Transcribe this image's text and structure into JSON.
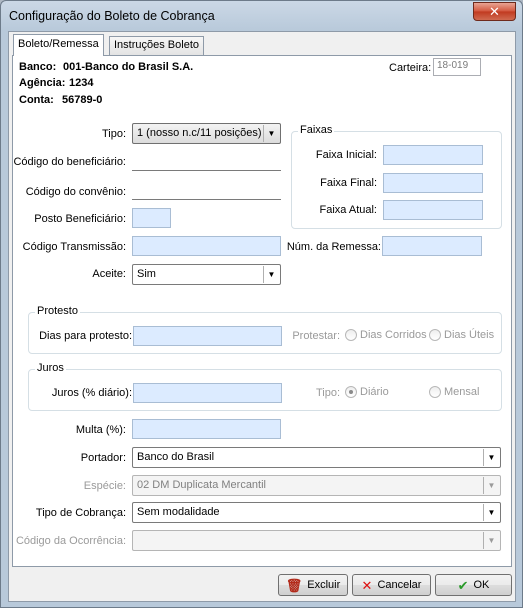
{
  "window": {
    "title": "Configuração do Boleto de Cobrança",
    "close_glyph": "✕"
  },
  "tabs": [
    {
      "label": "Boleto/Remessa",
      "active": true
    },
    {
      "label": "Instruções Boleto",
      "active": false
    }
  ],
  "header": {
    "banco_label": "Banco:",
    "banco_value": "001-Banco do Brasil S.A.",
    "agencia_label": "Agência:",
    "agencia_value": "1234",
    "conta_label": "Conta:",
    "conta_value": "56789-0",
    "carteira_label": "Carteira:",
    "carteira_value": "18-019"
  },
  "form": {
    "tipo_label": "Tipo:",
    "tipo_value": "1 (nosso n.c/11 posições)",
    "codigo_beneficiario_label": "Código do beneficiário:",
    "codigo_beneficiario_value": "",
    "codigo_convenio_label": "Código do convênio:",
    "codigo_convenio_value": "",
    "posto_beneficiario_label": "Posto Beneficiário:",
    "posto_beneficiario_value": "",
    "codigo_transmissao_label": "Código Transmissão:",
    "codigo_transmissao_value": "",
    "aceite_label": "Aceite:",
    "aceite_value": "Sim",
    "num_remessa_label": "Núm. da Remessa:",
    "num_remessa_value": ""
  },
  "faixas": {
    "title": "Faixas",
    "inicial_label": "Faixa Inicial:",
    "final_label": "Faixa Final:",
    "atual_label": "Faixa Atual:"
  },
  "protesto": {
    "title": "Protesto",
    "dias_label": "Dias para protesto:",
    "dias_value": "",
    "protestar_label": "Protestar:",
    "options": [
      {
        "label": "Dias Corridos",
        "selected": false
      },
      {
        "label": "Dias Úteis",
        "selected": false
      }
    ]
  },
  "juros": {
    "title": "Juros",
    "juros_label": "Juros (% diário):",
    "juros_value": "",
    "tipo_label": "Tipo:",
    "options": [
      {
        "label": "Diário",
        "selected": true
      },
      {
        "label": "Mensal",
        "selected": false
      }
    ]
  },
  "multa": {
    "label": "Multa (%):",
    "value": ""
  },
  "portador": {
    "label": "Portador:",
    "value": "Banco do Brasil"
  },
  "especie": {
    "label": "Espécie:",
    "value": "02 DM Duplicata Mercantil"
  },
  "tipo_cobranca": {
    "label": "Tipo de Cobrança:",
    "value": "Sem modalidade"
  },
  "codigo_ocorrencia": {
    "label": "Código da Ocorrência:",
    "value": ""
  },
  "buttons": {
    "excluir": "Excluir",
    "cancelar": "Cancelar",
    "ok": "OK"
  },
  "colors": {
    "input_background": "#dcebff",
    "close_button": "#c0391f"
  },
  "icons": {
    "dropdown": "▼",
    "trash": "🗑",
    "cancel": "✕",
    "ok": "✔"
  }
}
